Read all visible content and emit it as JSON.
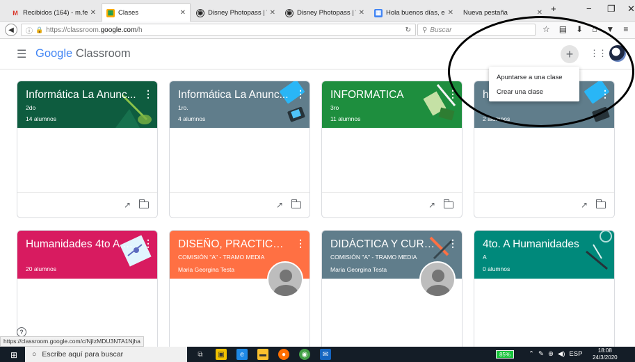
{
  "browser": {
    "tabs": [
      {
        "label": "Recibidos (164) - m.fer...",
        "icon": "gmail-icon"
      },
      {
        "label": "Clases",
        "icon": "classroom-icon"
      },
      {
        "label": "Disney Photopass | Wa...",
        "icon": "disney-icon"
      },
      {
        "label": "Disney Photopass | Wa...",
        "icon": "disney-icon"
      },
      {
        "label": "Hola buenos días, esp...",
        "icon": "classroom-icon"
      },
      {
        "label": "Nueva pestaña",
        "icon": ""
      }
    ],
    "url_prefix": "https://classroom.",
    "url_host": "google.com",
    "url_path": "/h",
    "search_placeholder": "Buscar"
  },
  "app": {
    "brand_google": "Google",
    "brand_product": "Classroom"
  },
  "menu": {
    "items": [
      "Apuntarse a una clase",
      "Crear una clase"
    ]
  },
  "cards": [
    {
      "title": "Informática La Anunc...",
      "section": "2do",
      "students": "14 alumnos",
      "color": "#0e5c3f"
    },
    {
      "title": "Informática La Anunc...",
      "section": "1ro.",
      "students": "4 alumnos",
      "color": "#607d8b"
    },
    {
      "title": "INFORMATICA",
      "section": "3ro",
      "students": "11 alumnos",
      "color": "#1e8e3e"
    },
    {
      "title": "hu",
      "section": "",
      "students": "2 alumnos",
      "color": "#607d8b"
    },
    {
      "title": "Humanidades 4to A 2...",
      "section": "",
      "students": "20 alumnos",
      "color": "#d81b60"
    },
    {
      "title": "DISEÑO, PRACTICA Y...",
      "section": "COMISIÓN \"A\" - TRAMO MEDIA",
      "teacher": "Maria Georgina Testa",
      "color": "#ff7043"
    },
    {
      "title": "DIDÁCTICA Y CURRI...",
      "section": "COMISIÓN \"A\" - TRAMO MEDIA",
      "teacher": "Maria Georgina Testa",
      "color": "#607d8b"
    },
    {
      "title": "4to. A Humanidades",
      "section": "A",
      "students": "0 alumnos",
      "color": "#00897b"
    }
  ],
  "status_url": "https://classroom.google.com/c/NjIzMDU3NTA1Njha",
  "taskbar": {
    "search_text": "Escribe aquí para buscar",
    "battery": "85%",
    "lang": "ESP",
    "time": "18:08",
    "date": "24/3/2020"
  }
}
